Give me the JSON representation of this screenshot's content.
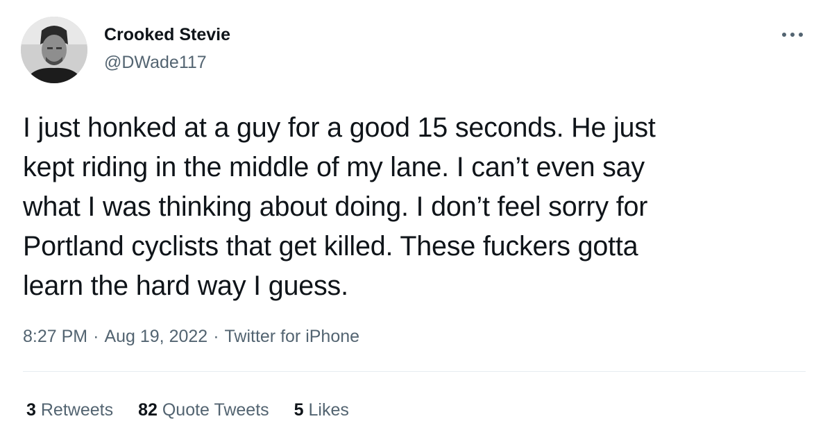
{
  "author": {
    "display_name": "Crooked Stevie",
    "handle": "@DWade117",
    "avatar_icon": "profile-photo-icon"
  },
  "more_icon": "more-options-icon",
  "tweet": {
    "text": "I just honked at a guy for a good 15 seconds. He just\nkept riding in the middle of my lane. I can’t even say\nwhat I was thinking about doing. I don’t feel sorry for\nPortland cyclists that get killed. These fuckers gotta\nlearn the hard way I guess."
  },
  "meta": {
    "time": "8:27 PM",
    "separator": "·",
    "date": "Aug 19, 2022",
    "source": "Twitter for iPhone"
  },
  "stats": {
    "retweets": {
      "count": "3",
      "label": "Retweets"
    },
    "quote_tweets": {
      "count": "82",
      "label": "Quote Tweets"
    },
    "likes": {
      "count": "5",
      "label": "Likes"
    }
  },
  "colors": {
    "text_primary": "#0f1419",
    "text_secondary": "#536471",
    "divider": "#e6ecf0"
  }
}
